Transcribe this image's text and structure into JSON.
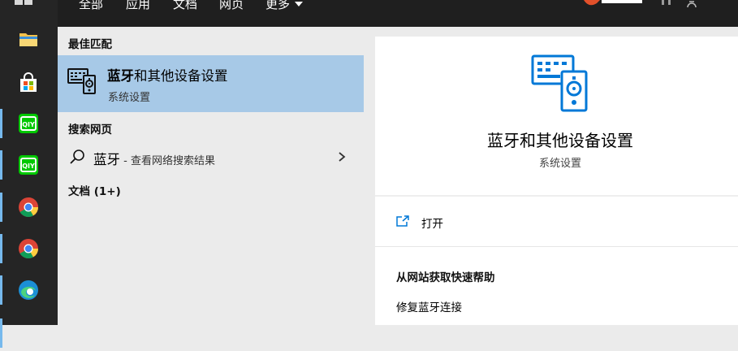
{
  "tabs": [
    {
      "label": "全部",
      "active": true
    },
    {
      "label": "应用"
    },
    {
      "label": "文档"
    },
    {
      "label": "网页"
    },
    {
      "label": "更多"
    }
  ],
  "taskbar": {
    "items": [
      {
        "icon": "file-explorer-icon"
      },
      {
        "icon": "microsoft-store-icon"
      },
      {
        "icon": "iqiyi-icon"
      },
      {
        "icon": "iqiyi-icon"
      },
      {
        "icon": "chrome-icon"
      },
      {
        "icon": "chrome-icon"
      },
      {
        "icon": "edge-icon"
      }
    ]
  },
  "results": {
    "best_match_header": "最佳匹配",
    "best_match": {
      "title_bold": "蓝牙",
      "title_rest": "和其他设备设置",
      "subtitle": "系统设置",
      "icon": "bluetooth-devices-icon"
    },
    "web_header": "搜索网页",
    "web_item": {
      "query": "蓝牙",
      "separator": " - ",
      "suffix": "查看网络搜索结果"
    },
    "docs_header": "文档 (1+)"
  },
  "detail": {
    "title": "蓝牙和其他设备设置",
    "subtitle": "系统设置",
    "open_label": "打开",
    "help_header": "从网站获取快速帮助",
    "help_link": "修复蓝牙连接"
  },
  "colors": {
    "accent": "#0078d7",
    "selected_bg": "#a7c9e7",
    "taskbar_bg": "#252525",
    "topbar_bg": "#1f1f1f"
  }
}
